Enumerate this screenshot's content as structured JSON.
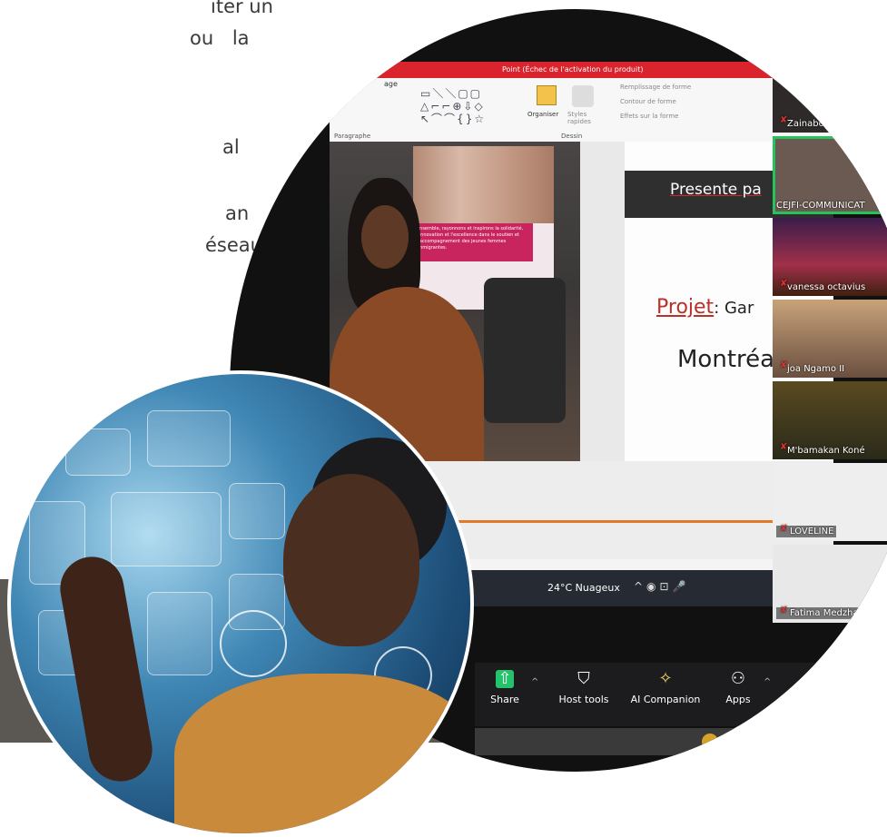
{
  "left_text": {
    "lines": [
      "iter un",
      "ou  la",
      "al",
      "an",
      "éseaux"
    ]
  },
  "ppt": {
    "title_bar": "Point (Échec de l'activation du produit)",
    "tab": "age",
    "groups": [
      "Paragraphe",
      "Dessin"
    ],
    "buttons": [
      "Organiser",
      "Styles rapides",
      "Remplissage de forme",
      "Contour de forme",
      "Effets sur la forme"
    ],
    "poster_text": "Ensemble, rayonnons et inspirons la solidarité, l'innovation et l'excellence dans le soutien et l'accompagnement des jeunes femmes immigrantes.",
    "slide": {
      "presente": "Presente pa",
      "projet_label": "Projet",
      "projet_rest": ": Gar",
      "montreal": "Montréa"
    },
    "weather": "24°C  Nuageux"
  },
  "participants": [
    {
      "name": "Zainabou Ouedr",
      "active": false,
      "color": "#2e2a2a"
    },
    {
      "name": "CEJFI-COMMUNICAT",
      "active": true,
      "color": "#6b5a52"
    },
    {
      "name": "vanessa octavius",
      "active": false,
      "color": "#5a2038"
    },
    {
      "name": "joa Ngamo II",
      "active": false,
      "color": "#7a6a58"
    },
    {
      "name": "M'bamakan Koné",
      "active": false,
      "color": "#3f3a2a"
    },
    {
      "name": "LOVELINE",
      "active": false,
      "color": "#eeeeee"
    },
    {
      "name": "Fatima Medzhakhe",
      "active": false,
      "color": "#e8e8e8"
    }
  ],
  "toolbar": {
    "share": "Share",
    "host_tools": "Host tools",
    "ai_companion": "AI Companion",
    "apps": "Apps"
  }
}
